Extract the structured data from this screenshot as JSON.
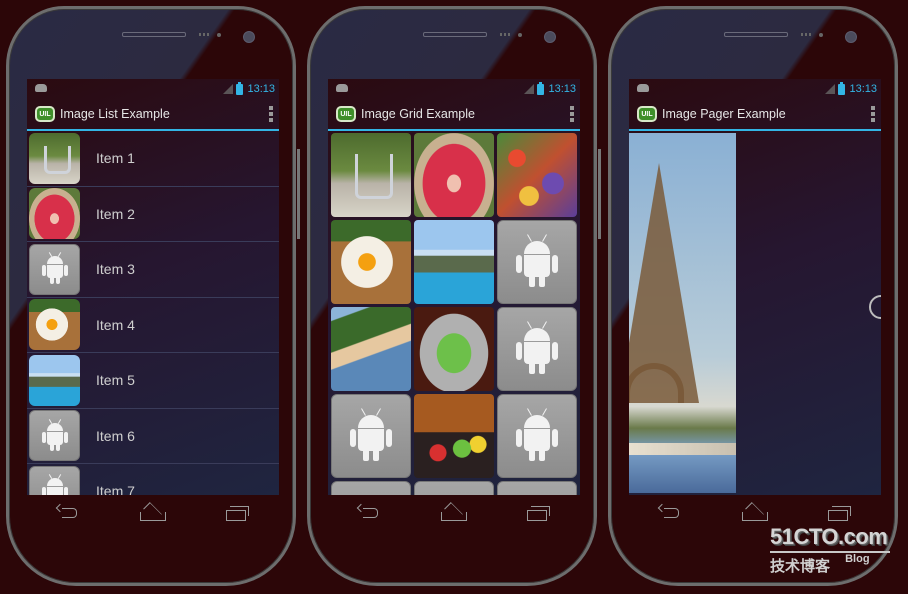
{
  "status_bar": {
    "time": "13:13"
  },
  "app_icon_label": "UIL",
  "phones": [
    {
      "title": "Image List Example"
    },
    {
      "title": "Image Grid Example"
    },
    {
      "title": "Image Pager Example"
    }
  ],
  "list": {
    "items": [
      {
        "label": "Item 1",
        "thumb": "sculpture"
      },
      {
        "label": "Item 2",
        "thumb": "roses"
      },
      {
        "label": "Item 3",
        "thumb": "android-placeholder"
      },
      {
        "label": "Item 4",
        "thumb": "egg"
      },
      {
        "label": "Item 5",
        "thumb": "pool"
      },
      {
        "label": "Item 6",
        "thumb": "android-placeholder"
      },
      {
        "label": "Item 7",
        "thumb": "android-placeholder"
      }
    ]
  },
  "grid": {
    "cells": [
      "sculpture",
      "roses",
      "fruit",
      "egg",
      "pool",
      "android-placeholder",
      "beach",
      "android-cake",
      "android-placeholder",
      "android-placeholder",
      "android-toys",
      "android-placeholder",
      "android-placeholder",
      "android-placeholder",
      "android-placeholder"
    ]
  },
  "pager": {
    "image": "eiffel-tower",
    "loading": true
  },
  "nav": {
    "back": "back-icon",
    "home": "home-icon",
    "recents": "recents-icon"
  },
  "watermark": {
    "main": "51CTO.com",
    "sub": "技术博客",
    "blog": "Blog"
  }
}
